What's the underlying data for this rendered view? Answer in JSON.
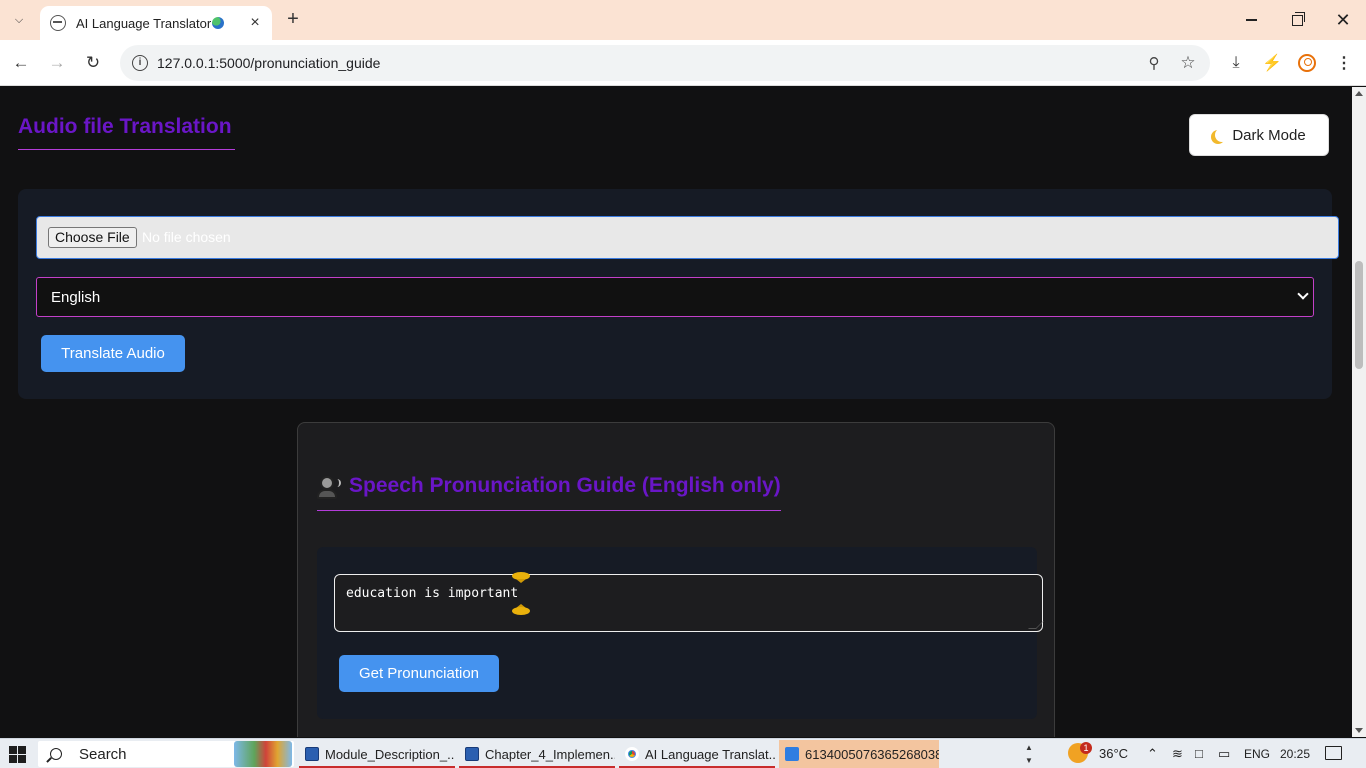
{
  "browser": {
    "tab_title": "AI Language Translator",
    "url": "127.0.0.1:5000/pronunciation_guide"
  },
  "page": {
    "audio_section_title": "Audio file Translation",
    "dark_mode_label": "Dark Mode",
    "file_input": {
      "button_label": "Choose File",
      "status": "No file chosen"
    },
    "language_select": {
      "selected": "English"
    },
    "translate_button": "Translate Audio",
    "pronunciation": {
      "title": "Speech Pronunciation Guide (English only)",
      "input_value": "education is important",
      "button_label": "Get Pronunciation"
    }
  },
  "taskbar": {
    "search_label": "Search",
    "items": [
      {
        "label": "Module_Description_...",
        "icon": "word-icon"
      },
      {
        "label": "Chapter_4_Implemen...",
        "icon": "word-icon"
      },
      {
        "label": "AI Language Translat...",
        "icon": "chrome-icon"
      },
      {
        "label": "6134005076365268038...",
        "icon": "photos-icon"
      }
    ],
    "weather_badge": "1",
    "temperature": "36°C",
    "language": "ENG",
    "time": "20:25"
  },
  "colors": {
    "heading_accent": "#6a16c7",
    "underline_accent": "#b33cd9",
    "button_blue": "#4593ef",
    "page_bg": "#111112",
    "card_bg": "#161b25"
  }
}
